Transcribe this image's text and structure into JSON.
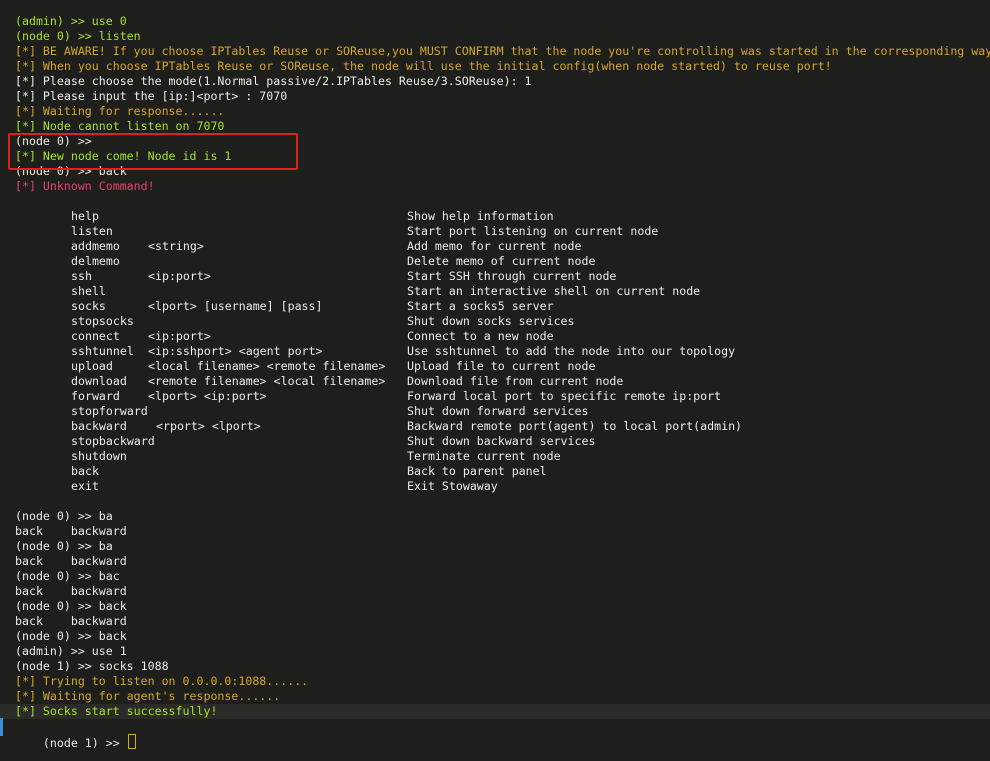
{
  "log_top": [
    {
      "text": "(admin) >> use 0",
      "style": "c-green"
    },
    {
      "text": "(node 0) >> listen",
      "style": "c-green"
    },
    {
      "text": "[*] BE AWARE! If you choose IPTables Reuse or SOReuse,you MUST CONFIRM that the node you're controlling was started in the corresponding way!",
      "style": "c-gold"
    },
    {
      "text": "[*] When you choose IPTables Reuse or SOReuse, the node will use the initial config(when node started) to reuse port!",
      "style": "c-gold"
    },
    {
      "text": "[*] Please choose the mode(1.Normal passive/2.IPTables Reuse/3.SOReuse): 1",
      "style": "c-white"
    },
    {
      "text": "[*] Please input the [ip:]<port> : 7070",
      "style": "c-white"
    },
    {
      "text": "[*] Waiting for response......",
      "style": "c-gold"
    },
    {
      "text": "[*] Node cannot listen on 7070",
      "style": "c-green"
    },
    {
      "text": "(node 0) >>",
      "style": "c-white"
    },
    {
      "text": "[*] New node come! Node id is 1",
      "style": "c-green"
    },
    {
      "text": "(node 0) >> back",
      "style": "c-white"
    },
    {
      "text": "[*] Unknown Command!",
      "style": "c-red"
    }
  ],
  "help": [
    {
      "cmd": "help",
      "arg": "",
      "desc": "Show help information"
    },
    {
      "cmd": "listen",
      "arg": "",
      "desc": "Start port listening on current node"
    },
    {
      "cmd": "addmemo",
      "arg": "<string>",
      "desc": "Add memo for current node"
    },
    {
      "cmd": "delmemo",
      "arg": "",
      "desc": "Delete memo of current node"
    },
    {
      "cmd": "ssh",
      "arg": "<ip:port>",
      "desc": "Start SSH through current node"
    },
    {
      "cmd": "shell",
      "arg": "",
      "desc": "Start an interactive shell on current node"
    },
    {
      "cmd": "socks",
      "arg": "<lport> [username] [pass]",
      "desc": "Start a socks5 server"
    },
    {
      "cmd": "stopsocks",
      "arg": "",
      "desc": "Shut down socks services"
    },
    {
      "cmd": "connect",
      "arg": "<ip:port>",
      "desc": "Connect to a new node"
    },
    {
      "cmd": "sshtunnel",
      "arg": "<ip:sshport> <agent port>",
      "desc": "Use sshtunnel to add the node into our topology"
    },
    {
      "cmd": "upload",
      "arg": "<local filename> <remote filename>",
      "desc": "Upload file to current node"
    },
    {
      "cmd": "download",
      "arg": "<remote filename> <local filename>",
      "desc": "Download file from current node"
    },
    {
      "cmd": "forward",
      "arg": "<lport> <ip:port>",
      "desc": "Forward local port to specific remote ip:port"
    },
    {
      "cmd": "stopforward",
      "arg": "",
      "desc": "Shut down forward services"
    },
    {
      "cmd": "backward",
      "arg": "<rport> <lport>",
      "desc": "Backward remote port(agent) to local port(admin)"
    },
    {
      "cmd": "stopbackward",
      "arg": "",
      "desc": "Shut down backward services"
    },
    {
      "cmd": "shutdown",
      "arg": "",
      "desc": "Terminate current node"
    },
    {
      "cmd": "back",
      "arg": "",
      "desc": "Back to parent panel"
    },
    {
      "cmd": "exit",
      "arg": "",
      "desc": "Exit Stowaway"
    }
  ],
  "log_bottom": [
    {
      "text": "(node 0) >> ba",
      "style": "c-white"
    },
    {
      "text": "back    backward",
      "style": "c-white"
    },
    {
      "text": "(node 0) >> ba",
      "style": "c-white"
    },
    {
      "text": "back    backward",
      "style": "c-white"
    },
    {
      "text": "(node 0) >> bac",
      "style": "c-white"
    },
    {
      "text": "back    backward",
      "style": "c-white"
    },
    {
      "text": "(node 0) >> back",
      "style": "c-white"
    },
    {
      "text": "back    backward",
      "style": "c-white"
    },
    {
      "text": "(node 0) >> back",
      "style": "c-white"
    },
    {
      "text": "(admin) >> use 1",
      "style": "c-white"
    },
    {
      "text": "(node 1) >> socks 1088",
      "style": "c-white"
    },
    {
      "text": "[*] Trying to listen on 0.0.0.0:1088......",
      "style": "c-gold"
    },
    {
      "text": "[*] Waiting for agent's response......",
      "style": "c-gold"
    },
    {
      "text": "[*] Socks start successfully!",
      "style": "c-green"
    }
  ],
  "prompt": {
    "text": "(node 1) >> "
  },
  "colors": {
    "background": "#1e1f1c",
    "green": "#a6e22e",
    "gold": "#d4a72c",
    "white": "#ececec",
    "red": "#e0446a",
    "highlight_box": "#e02020"
  }
}
